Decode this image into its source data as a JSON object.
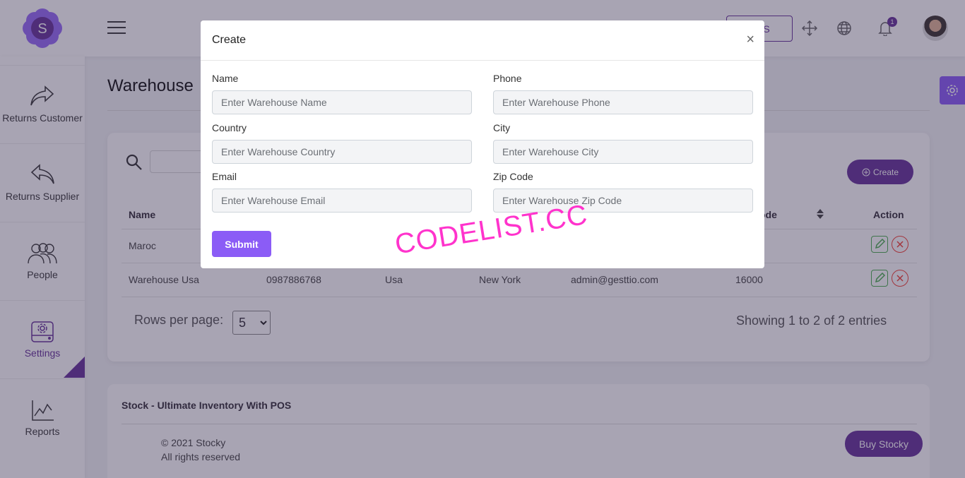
{
  "header": {
    "logo_letter": "S",
    "pos_label": "POS",
    "notification_count": "1"
  },
  "sidebar": {
    "items": [
      {
        "label": "Returns Customer",
        "icon": "share-forward-icon"
      },
      {
        "label": "Returns Supplier",
        "icon": "reply-back-icon"
      },
      {
        "label": "People",
        "icon": "people-icon"
      },
      {
        "label": "Settings",
        "icon": "settings-drive-icon",
        "active": true
      },
      {
        "label": "Reports",
        "icon": "chart-line-icon"
      }
    ]
  },
  "page": {
    "title": "Warehouse",
    "create_label": "Create",
    "columns": [
      "Name",
      "Zip Code",
      "Action"
    ],
    "rows": [
      {
        "name": "Maroc",
        "phone": "",
        "country": "",
        "city": "",
        "email": "",
        "zip": ""
      },
      {
        "name": "Warehouse Usa",
        "phone": "0987886768",
        "country": "Usa",
        "city": "New York",
        "email": "admin@gesttio.com",
        "zip": "16000"
      }
    ],
    "rows_per_page_label": "Rows per page:",
    "rows_per_page_value": "5",
    "showing_text": "Showing 1 to 2 of 2 entries"
  },
  "footer": {
    "title": "Stock - Ultimate Inventory With POS",
    "copyright": "© 2021 Stocky",
    "rights": "All rights reserved",
    "buy_label": "Buy Stocky"
  },
  "modal": {
    "title": "Create",
    "close_symbol": "×",
    "fields": {
      "name": {
        "label": "Name",
        "placeholder": "Enter Warehouse Name"
      },
      "phone": {
        "label": "Phone",
        "placeholder": "Enter Warehouse Phone"
      },
      "country": {
        "label": "Country",
        "placeholder": "Enter Warehouse Country"
      },
      "city": {
        "label": "City",
        "placeholder": "Enter Warehouse City"
      },
      "email": {
        "label": "Email",
        "placeholder": "Enter Warehouse Email"
      },
      "zip": {
        "label": "Zip Code",
        "placeholder": "Enter Warehouse Zip Code"
      }
    },
    "submit_label": "Submit"
  },
  "watermark": "CODELIST.CC",
  "colors": {
    "accent": "#663399",
    "button_violet": "#8b5cf6",
    "watermark": "#ff33cc"
  }
}
